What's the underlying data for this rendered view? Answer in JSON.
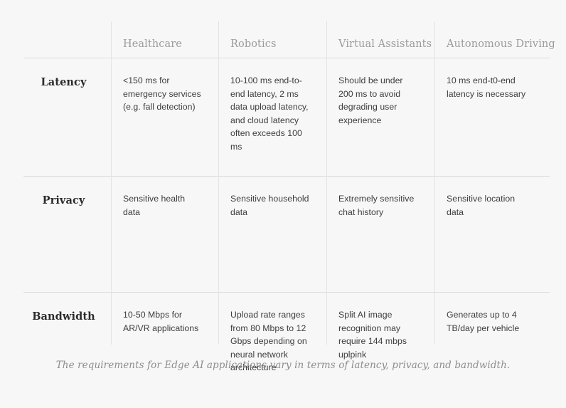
{
  "table": {
    "corner_label": "",
    "columns": [
      "Healthcare",
      "Robotics",
      "Virtual Assistants",
      "Autonomous Driving"
    ],
    "rows": [
      {
        "label": "Latency",
        "cells": [
          "<150 ms for emergency services (e.g. fall detection)",
          "10-100 ms end-to-end latency, 2 ms data upload latency, and cloud latency often exceeds 100 ms",
          "Should be under 200 ms to avoid degrading user experience",
          "10 ms end-t0-end latency is necessary"
        ]
      },
      {
        "label": "Privacy",
        "cells": [
          "Sensitive health data",
          "Sensitive household data",
          "Extremely sensitive chat history",
          "Sensitive location data"
        ]
      },
      {
        "label": "Bandwidth",
        "cells": [
          "10-50 Mbps for AR/VR applications",
          "Upload rate ranges from 80 Mbps to 12 Gbps depending on neural network architecture",
          "Split AI image recognition may require 144 mbps uplpink",
          "Generates up to 4 TB/day per vehicle"
        ]
      }
    ]
  },
  "caption": "The requirements for Edge AI applications vary in terms of latency, privacy, and bandwidth.",
  "colors": {
    "background": "#f7f7f7",
    "header_text": "#9b9b9b",
    "row_label_text": "#2b2b2b",
    "body_text": "#3d3d3d",
    "rule": "#dcdcdc",
    "divider": "#e3e3e3",
    "caption_text": "#8d8d8d"
  }
}
